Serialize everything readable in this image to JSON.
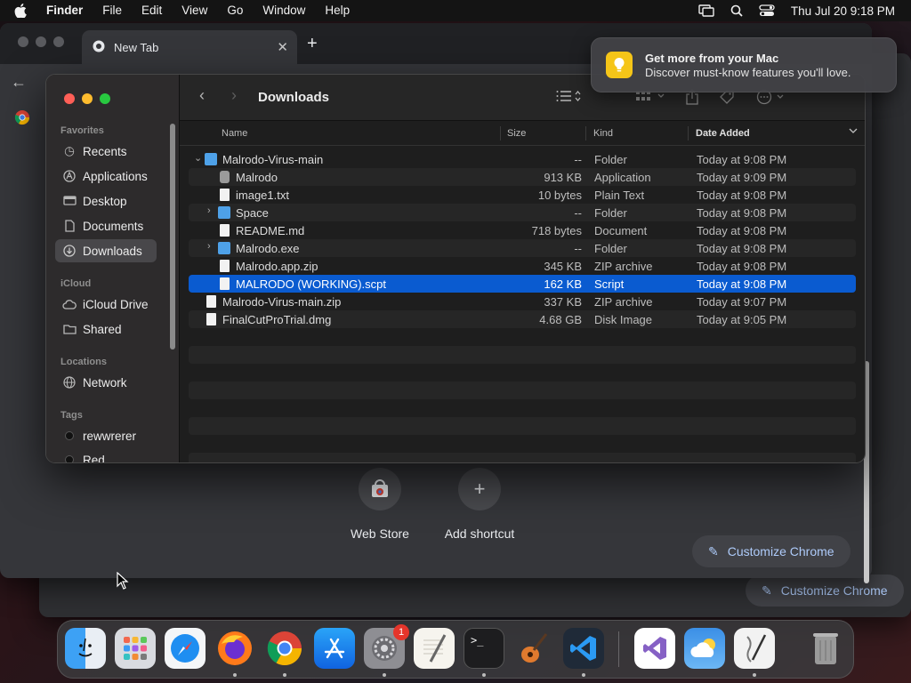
{
  "menubar": {
    "app_name": "Finder",
    "items": [
      "File",
      "Edit",
      "View",
      "Go",
      "Window",
      "Help"
    ],
    "clock": "Thu Jul 20  9:18 PM"
  },
  "chrome": {
    "tab_title": "New Tab",
    "tab_close": "✕",
    "new_tab": "+",
    "back": "←",
    "menu": "⋮",
    "tiles": [
      {
        "label": "Web Store"
      },
      {
        "label": "Add shortcut"
      }
    ],
    "customize_label": "Customize Chrome",
    "customize_label_back": "Customize Chrome"
  },
  "notification": {
    "title": "Get more from your Mac",
    "body": "Discover must-know features you'll love."
  },
  "finder": {
    "title": "Downloads",
    "sidebar": {
      "favorites_header": "Favorites",
      "favorites": [
        "Recents",
        "Applications",
        "Desktop",
        "Documents",
        "Downloads"
      ],
      "icloud_header": "iCloud",
      "icloud": [
        "iCloud Drive",
        "Shared"
      ],
      "locations_header": "Locations",
      "locations": [
        "Network"
      ],
      "tags_header": "Tags",
      "tags": [
        "rewwrerer",
        "Red"
      ]
    },
    "columns": {
      "name": "Name",
      "size": "Size",
      "kind": "Kind",
      "date": "Date Added"
    },
    "rows": [
      {
        "name": "Malrodo-Virus-main",
        "size": "--",
        "kind": "Folder",
        "date": "Today at 9:08 PM",
        "level": 0,
        "disclosure": "⌄",
        "icon": "folder-icon"
      },
      {
        "name": "Malrodo",
        "size": "913 KB",
        "kind": "Application",
        "date": "Today at 9:09 PM",
        "level": 1,
        "disclosure": "",
        "icon": "script-app-icon"
      },
      {
        "name": "image1.txt",
        "size": "10 bytes",
        "kind": "Plain Text",
        "date": "Today at 9:08 PM",
        "level": 1,
        "disclosure": "",
        "icon": "text-file-icon"
      },
      {
        "name": "Space",
        "size": "--",
        "kind": "Folder",
        "date": "Today at 9:08 PM",
        "level": 1,
        "disclosure": "›",
        "icon": "folder-icon"
      },
      {
        "name": "README.md",
        "size": "718 bytes",
        "kind": "Document",
        "date": "Today at 9:08 PM",
        "level": 1,
        "disclosure": "",
        "icon": "document-icon"
      },
      {
        "name": "Malrodo.exe",
        "size": "--",
        "kind": "Folder",
        "date": "Today at 9:08 PM",
        "level": 1,
        "disclosure": "›",
        "icon": "folder-icon"
      },
      {
        "name": "Malrodo.app.zip",
        "size": "345 KB",
        "kind": "ZIP archive",
        "date": "Today at 9:08 PM",
        "level": 1,
        "disclosure": "",
        "icon": "zip-file-icon"
      },
      {
        "name": "MALRODO (WORKING).scpt",
        "size": "162 KB",
        "kind": "Script",
        "date": "Today at 9:08 PM",
        "level": 1,
        "disclosure": "",
        "icon": "script-file-icon",
        "selected": true
      },
      {
        "name": "Malrodo-Virus-main.zip",
        "size": "337 KB",
        "kind": "ZIP archive",
        "date": "Today at 9:07 PM",
        "level": 0,
        "disclosure": "",
        "icon": "zip-file-icon"
      },
      {
        "name": "FinalCutProTrial.dmg",
        "size": "4.68 GB",
        "kind": "Disk Image",
        "date": "Today at 9:05 PM",
        "level": 0,
        "disclosure": "",
        "icon": "disk-image-icon"
      }
    ]
  },
  "dock": {
    "apps": [
      "Finder",
      "Launchpad",
      "Safari",
      "Firefox",
      "Chrome",
      "App Store",
      "System Settings",
      "TextEdit",
      "Terminal",
      "GarageBand",
      "Visual Studio Code",
      "Visual Studio",
      "Weather",
      "Script Editor",
      "Trash"
    ],
    "settings_badge": "1"
  },
  "colors": {
    "selection": "#0a5bd0",
    "folder": "#4ea1e8",
    "accent_link": "#aecbfa"
  }
}
